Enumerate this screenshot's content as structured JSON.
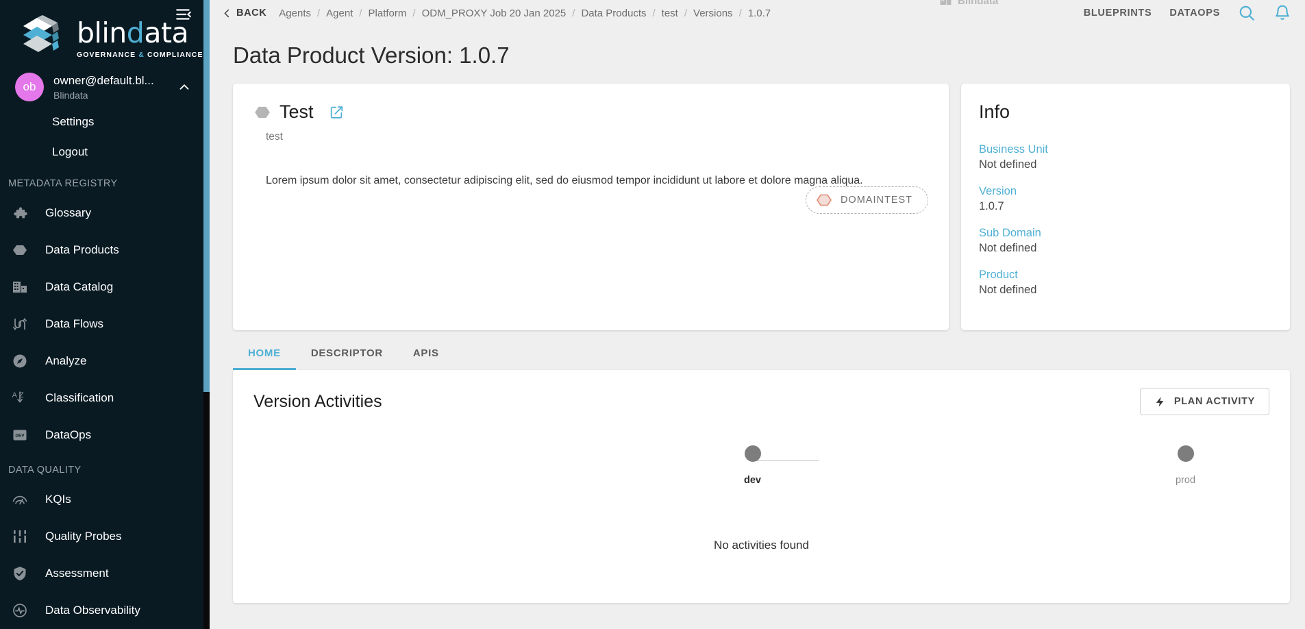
{
  "brand": {
    "word_a": "blin",
    "word_b": "d",
    "word_c": "ata",
    "tagline_a": "GOVERNANCE ",
    "tagline_amp": "&",
    "tagline_b": " COMPLIANCE",
    "accent_color": "#4fb0d4"
  },
  "user": {
    "initials": "ob",
    "email": "owner@default.bl...",
    "tenant": "Blindata",
    "menu": [
      {
        "label": "Settings",
        "name": "sidebar-settings"
      },
      {
        "label": "Logout",
        "name": "sidebar-logout"
      }
    ]
  },
  "sidebar": {
    "sections": [
      {
        "title": "METADATA REGISTRY",
        "items": [
          {
            "label": "Glossary",
            "icon": "puzzle-icon"
          },
          {
            "label": "Data Products",
            "icon": "hexagon-icon"
          },
          {
            "label": "Data Catalog",
            "icon": "building-icon"
          },
          {
            "label": "Data Flows",
            "icon": "dataflow-icon"
          },
          {
            "label": "Analyze",
            "icon": "compass-icon"
          },
          {
            "label": "Classification",
            "icon": "az-sort-icon"
          },
          {
            "label": "DataOps",
            "icon": "dev-badge-icon"
          }
        ]
      },
      {
        "title": "DATA QUALITY",
        "items": [
          {
            "label": "KQIs",
            "icon": "speedometer-icon"
          },
          {
            "label": "Quality Probes",
            "icon": "sliders-icon"
          },
          {
            "label": "Assessment",
            "icon": "shield-check-icon"
          },
          {
            "label": "Data Observability",
            "icon": "pulse-icon"
          }
        ]
      }
    ]
  },
  "topbar": {
    "back_label": "BACK",
    "breadcrumbs": [
      "Agents",
      "Agent",
      "Platform",
      "ODM_PROXY Job 20 Jan 2025",
      "Data Products",
      "test",
      "Versions",
      "1.0.7"
    ],
    "separator": "/",
    "tenant_label": "Blindata",
    "links": [
      {
        "label": "BLUEPRINTS",
        "name": "top-link-blueprints"
      },
      {
        "label": "DATAOPS",
        "name": "top-link-dataops"
      }
    ]
  },
  "page": {
    "title": "Data Product Version: 1.0.7"
  },
  "product": {
    "name": "Test",
    "subtitle": "test",
    "description": "Lorem ipsum dolor sit amet, consectetur adipiscing elit, sed do eiusmod tempor incididunt ut labore et dolore magna aliqua.",
    "domain_chip": "DOMAINTEST",
    "domain_chip_color": "#e59584"
  },
  "info": {
    "title": "Info",
    "fields": [
      {
        "key": "Business Unit",
        "value": "Not defined"
      },
      {
        "key": "Version",
        "value": "1.0.7"
      },
      {
        "key": "Sub Domain",
        "value": "Not defined"
      },
      {
        "key": "Product",
        "value": "Not defined"
      }
    ]
  },
  "tabs": [
    {
      "label": "HOME",
      "active": true
    },
    {
      "label": "DESCRIPTOR",
      "active": false
    },
    {
      "label": "APIS",
      "active": false
    }
  ],
  "activities": {
    "title": "Version Activities",
    "plan_button": "PLAN ACTIVITY",
    "stages": [
      {
        "label": "dev",
        "active": true
      },
      {
        "label": "prod",
        "active": false
      }
    ],
    "empty_message": "No activities found"
  }
}
